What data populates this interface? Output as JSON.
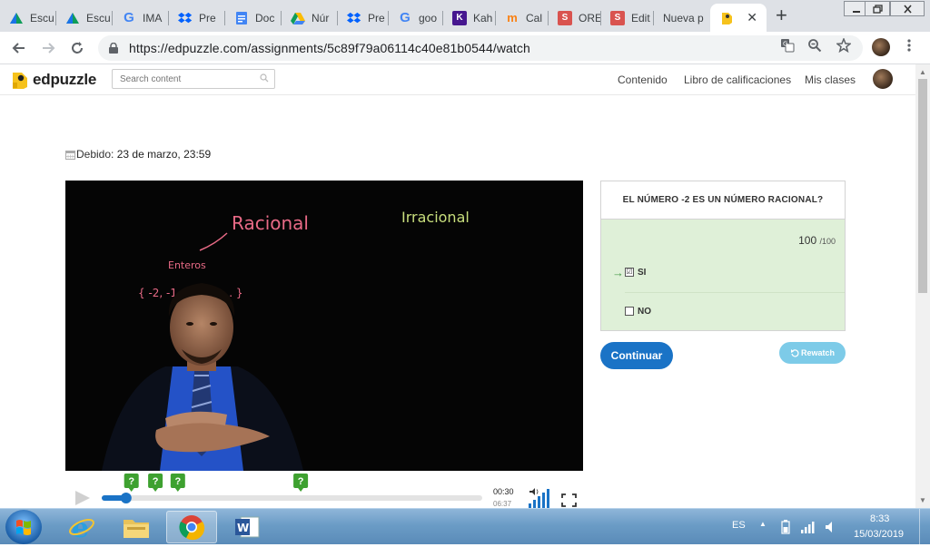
{
  "browser": {
    "tabs": [
      {
        "label": "Escu",
        "icon": "classroom-icon"
      },
      {
        "label": "Escu",
        "icon": "classroom-icon"
      },
      {
        "label": "IMA",
        "icon": "google-icon"
      },
      {
        "label": "Pre",
        "icon": "dropbox-icon"
      },
      {
        "label": "Doc",
        "icon": "docs-icon"
      },
      {
        "label": "Núr",
        "icon": "drive-icon"
      },
      {
        "label": "Pre",
        "icon": "dropbox-icon"
      },
      {
        "label": "goo",
        "icon": "google-icon"
      },
      {
        "label": "Kah",
        "icon": "kahoot-icon"
      },
      {
        "label": "Cal",
        "icon": "moodle-icon"
      },
      {
        "label": "ORE",
        "icon": "s-icon"
      },
      {
        "label": "Edit",
        "icon": "s-icon"
      },
      {
        "label": "Nueva p",
        "icon": ""
      }
    ],
    "active_tab": {
      "icon": "edpuzzle-icon",
      "close": "✕"
    },
    "new_tab": "+",
    "url": "https://edpuzzle.com/assignments/5c89f79a06114c40e81b0544/watch"
  },
  "edpuzzle": {
    "logo_text": "edpuzzle",
    "search_placeholder": "Search content",
    "nav": [
      "Contenido",
      "Libro de calificaciones",
      "Mis clases"
    ],
    "due_label": "Debido:",
    "due_value": "23 de marzo, 23:59"
  },
  "video": {
    "board_text": {
      "racional": "Racional",
      "irracional": "Irracional",
      "enteros": "Enteros",
      "set": "{ -2, -1, 0, 1, 2 ... }"
    },
    "time_current": "00:30",
    "time_total": "06:37",
    "progress_fraction": 0.064,
    "question_markers": [
      0.078,
      0.141,
      0.2,
      0.523
    ],
    "marker_symbol": "?"
  },
  "question": {
    "title": "EL NÚMERO -2 ES UN NÚMERO RACIONAL?",
    "score": "100",
    "score_max": "/100",
    "options": [
      {
        "label": "SI",
        "checked": "☑",
        "correct_arrow": "→"
      },
      {
        "label": "NO",
        "checked": "",
        "correct_arrow": ""
      }
    ],
    "continue_label": "Continuar",
    "rewatch_label": "Rewatch"
  },
  "taskbar": {
    "language": "ES",
    "time": "8:33",
    "date": "15/03/2019"
  },
  "colors": {
    "accent_blue": "#1a73c6",
    "rewatch_blue": "#7dcbe8",
    "correct_green_bg": "#dff0d8",
    "marker_green": "#3ea130",
    "logo_yellow": "#f6c21c"
  }
}
